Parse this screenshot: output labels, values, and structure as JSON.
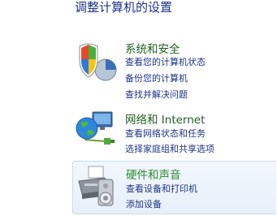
{
  "page_title": "调整计算机的设置",
  "categories": [
    {
      "title": "系统和安全",
      "links": [
        "查看您的计算机状态",
        "备份您的计算机",
        "查找并解决问题"
      ]
    },
    {
      "title": "网络和 Internet",
      "links": [
        "查看网络状态和任务",
        "选择家庭组和共享选项"
      ]
    },
    {
      "title": "硬件和声音",
      "links": [
        "查看设备和打印机",
        "添加设备"
      ]
    }
  ]
}
